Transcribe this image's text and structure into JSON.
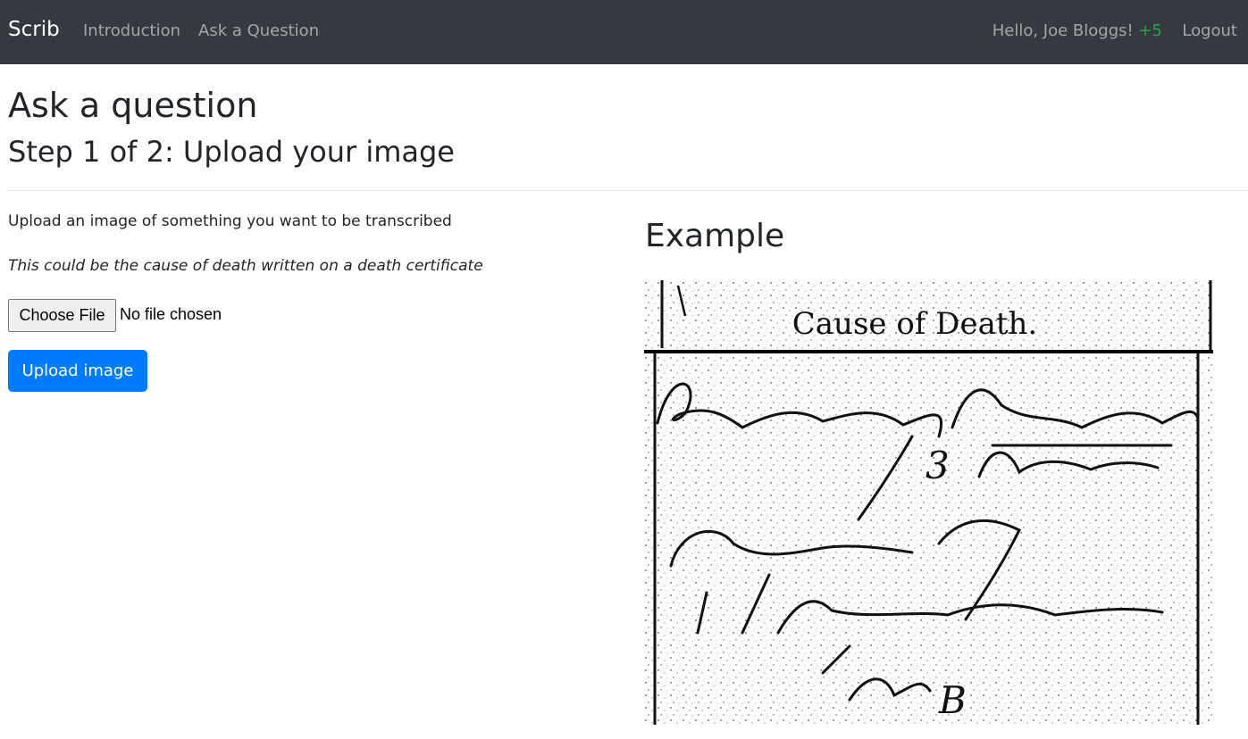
{
  "nav": {
    "brand": "Scrib",
    "links": [
      {
        "label": "Introduction"
      },
      {
        "label": "Ask a Question"
      }
    ],
    "greeting": "Hello, Joe Bloggs!",
    "points": "+5",
    "logout": "Logout"
  },
  "page": {
    "title": "Ask a question",
    "step": "Step 1 of 2: Upload your image",
    "lead": "Upload an image of something you want to be transcribed",
    "hint": "This could be the cause of death written on a death certificate"
  },
  "file_input": {
    "button_label": "Choose File",
    "status": "No file chosen"
  },
  "upload_button": "Upload image",
  "example": {
    "heading": "Example",
    "image": {
      "printed_header": "Cause of Death."
    }
  },
  "colors": {
    "navbar": "#343a40",
    "primary": "#007bff",
    "points": "#28a745"
  }
}
